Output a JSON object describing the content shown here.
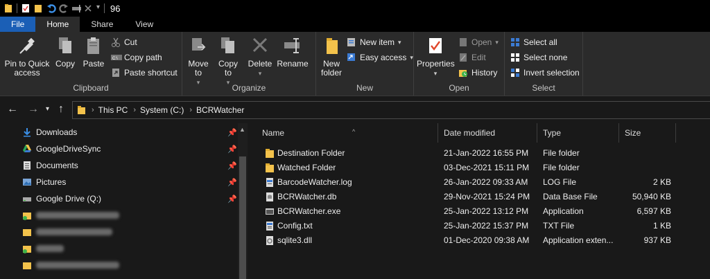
{
  "titlebar": {
    "title": "96"
  },
  "tabs": [
    {
      "label": "File"
    },
    {
      "label": "Home"
    },
    {
      "label": "Share"
    },
    {
      "label": "View"
    }
  ],
  "ribbon": {
    "clipboard": {
      "label": "Clipboard",
      "pin": "Pin to Quick access",
      "copy": "Copy",
      "paste": "Paste",
      "cut": "Cut",
      "copy_path": "Copy path",
      "paste_shortcut": "Paste shortcut"
    },
    "organize": {
      "label": "Organize",
      "move_to": "Move to",
      "copy_to": "Copy to",
      "delete": "Delete",
      "rename": "Rename"
    },
    "new": {
      "label": "New",
      "new_folder": "New folder",
      "new_item": "New item",
      "easy_access": "Easy access"
    },
    "open": {
      "label": "Open",
      "properties": "Properties",
      "open": "Open",
      "edit": "Edit",
      "history": "History"
    },
    "select": {
      "label": "Select",
      "select_all": "Select all",
      "select_none": "Select none",
      "invert_selection": "Invert selection"
    }
  },
  "address": {
    "crumbs": [
      "This PC",
      "System (C:)",
      "BCRWatcher"
    ]
  },
  "navpane": {
    "items": [
      {
        "label": "Downloads",
        "icon": "download-arrow-icon"
      },
      {
        "label": "GoogleDriveSync",
        "icon": "google-drive-icon"
      },
      {
        "label": "Documents",
        "icon": "documents-icon"
      },
      {
        "label": "Pictures",
        "icon": "pictures-icon"
      },
      {
        "label": "Google Drive (Q:)",
        "icon": "drive-icon"
      }
    ]
  },
  "columns": {
    "name": "Name",
    "date": "Date modified",
    "type": "Type",
    "size": "Size"
  },
  "files": [
    {
      "name": "Destination Folder",
      "date": "21-Jan-2022 16:55 PM",
      "type": "File folder",
      "size": "",
      "icon": "folder-icon"
    },
    {
      "name": "Watched Folder",
      "date": "03-Dec-2021 15:11 PM",
      "type": "File folder",
      "size": "",
      "icon": "folder-icon"
    },
    {
      "name": "BarcodeWatcher.log",
      "date": "26-Jan-2022 09:33 AM",
      "type": "LOG File",
      "size": "2 KB",
      "icon": "log-file-icon"
    },
    {
      "name": "BCRWatcher.db",
      "date": "29-Nov-2021 15:24 PM",
      "type": "Data Base File",
      "size": "50,940 KB",
      "icon": "db-file-icon"
    },
    {
      "name": "BCRWatcher.exe",
      "date": "25-Jan-2022 13:12 PM",
      "type": "Application",
      "size": "6,597 KB",
      "icon": "exe-file-icon"
    },
    {
      "name": "Config.txt",
      "date": "25-Jan-2022 15:37 PM",
      "type": "TXT File",
      "size": "1 KB",
      "icon": "txt-file-icon"
    },
    {
      "name": "sqlite3.dll",
      "date": "01-Dec-2020 09:38 AM",
      "type": "Application exten...",
      "size": "937 KB",
      "icon": "dll-file-icon"
    }
  ]
}
